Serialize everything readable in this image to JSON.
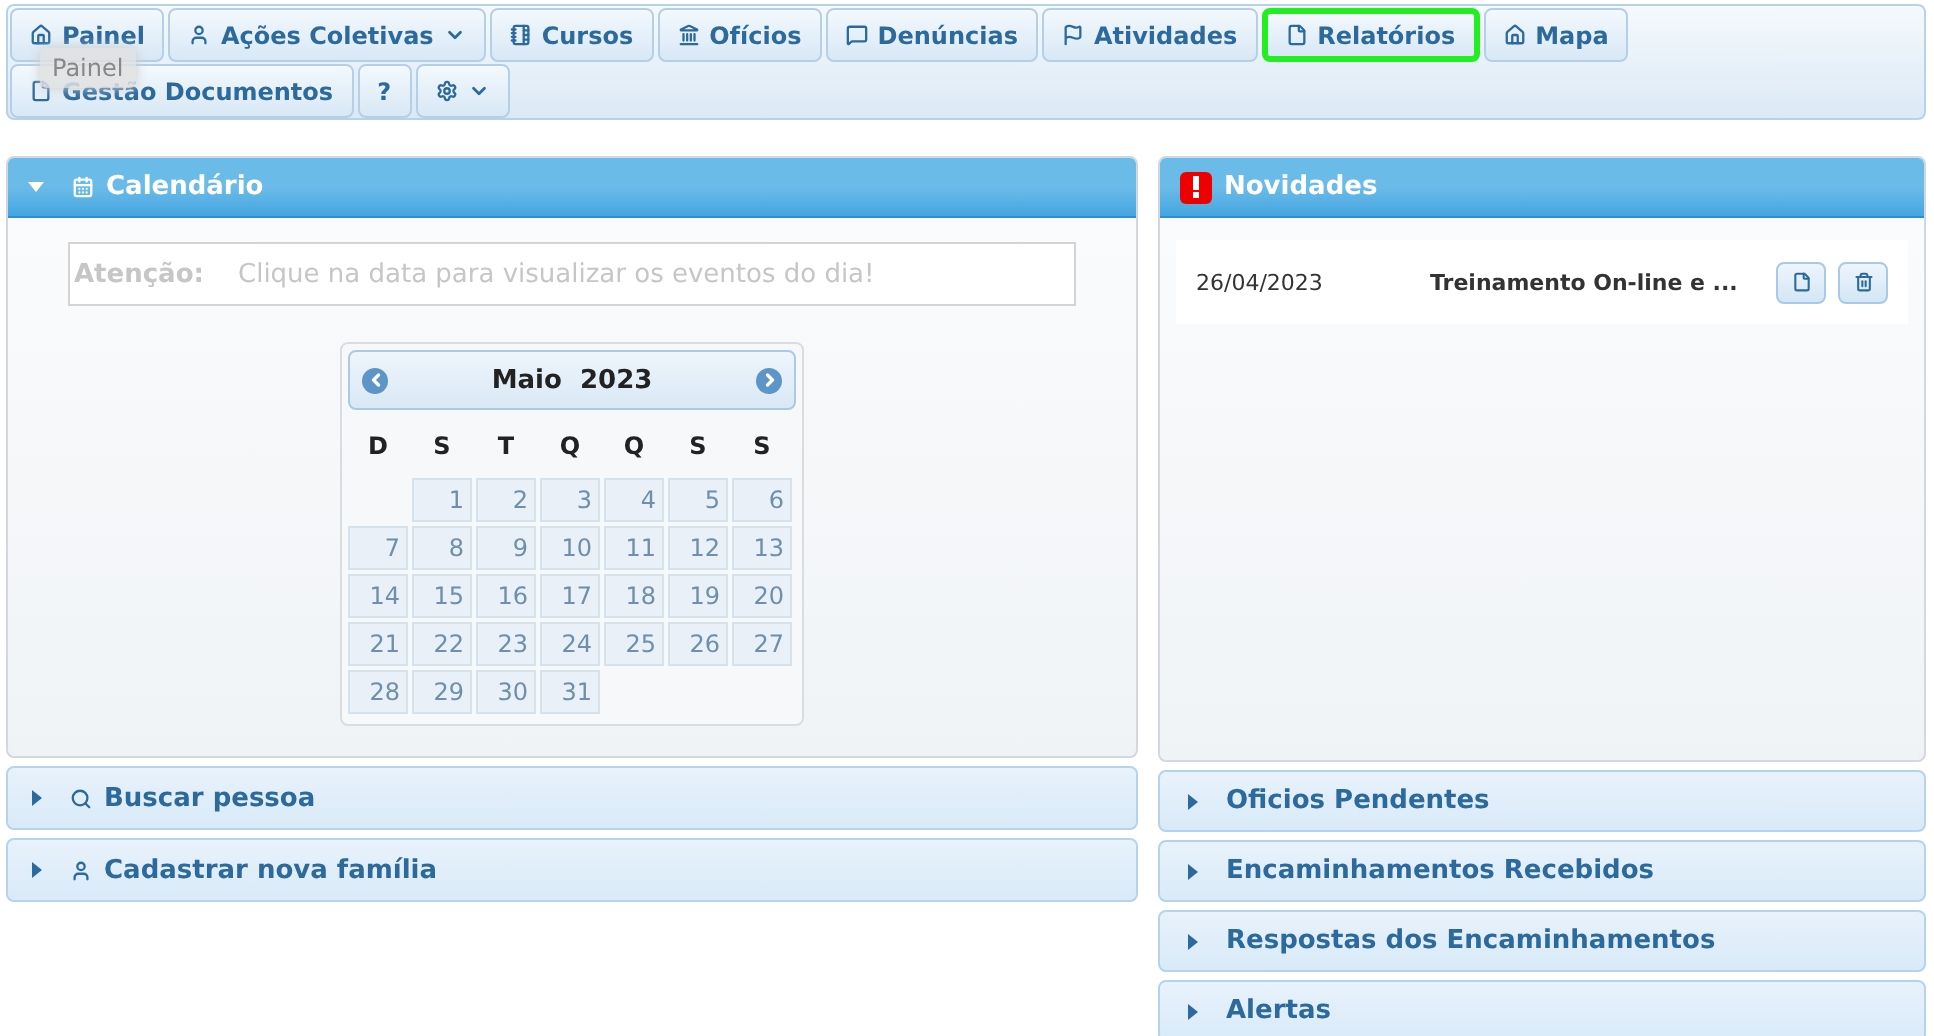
{
  "menu": [
    {
      "label": "Painel",
      "dropdown": false,
      "highlighted": false
    },
    {
      "label": "Ações Coletivas",
      "dropdown": true,
      "highlighted": false
    },
    {
      "label": "Cursos",
      "dropdown": false,
      "highlighted": false
    },
    {
      "label": "Ofícios",
      "dropdown": false,
      "highlighted": false
    },
    {
      "label": "Denúncias",
      "dropdown": false,
      "highlighted": false
    },
    {
      "label": "Atividades",
      "dropdown": false,
      "highlighted": false
    },
    {
      "label": "Relatórios",
      "dropdown": false,
      "highlighted": true
    },
    {
      "label": "Mapa",
      "dropdown": false,
      "highlighted": false
    },
    {
      "label": "Gestão Documentos",
      "dropdown": false,
      "highlighted": false
    },
    {
      "label": "?",
      "dropdown": false,
      "highlighted": false
    },
    {
      "dropdown": true,
      "highlighted": false
    }
  ],
  "tooltip": "Painel",
  "calendar_panel": {
    "title": "Calendário",
    "expanded": true,
    "notice": {
      "label": "Atenção:",
      "text": "Clique na data para visualizar os eventos do dia!"
    },
    "calendar": {
      "month": "Maio",
      "year": "2023",
      "weekdays": [
        "D",
        "S",
        "T",
        "Q",
        "Q",
        "S",
        "S"
      ],
      "weeks": [
        [
          "1",
          "2",
          "3",
          "4",
          "5",
          "6"
        ],
        [
          "7",
          "8",
          "9",
          "10",
          "11",
          "12",
          "13"
        ],
        [
          "14",
          "15",
          "16",
          "17",
          "18",
          "19",
          "20"
        ],
        [
          "21",
          "22",
          "23",
          "24",
          "25",
          "26",
          "27"
        ],
        [
          "28",
          "29",
          "30",
          "31"
        ]
      ]
    }
  },
  "left_sections": [
    {
      "title": "Buscar pessoa",
      "expanded": false
    },
    {
      "title": "Cadastrar nova família",
      "expanded": false
    }
  ],
  "news_panel": {
    "title": "Novidades",
    "items": [
      {
        "date": "26/04/2023",
        "title": "Treinamento On-line e ..."
      }
    ]
  },
  "right_sections": [
    {
      "title": "Oficios Pendentes",
      "expanded": false
    },
    {
      "title": "Encaminhamentos Recebidos",
      "expanded": false
    },
    {
      "title": "Respostas dos Encaminhamentos",
      "expanded": false
    },
    {
      "title": "Alertas",
      "expanded": false
    }
  ]
}
